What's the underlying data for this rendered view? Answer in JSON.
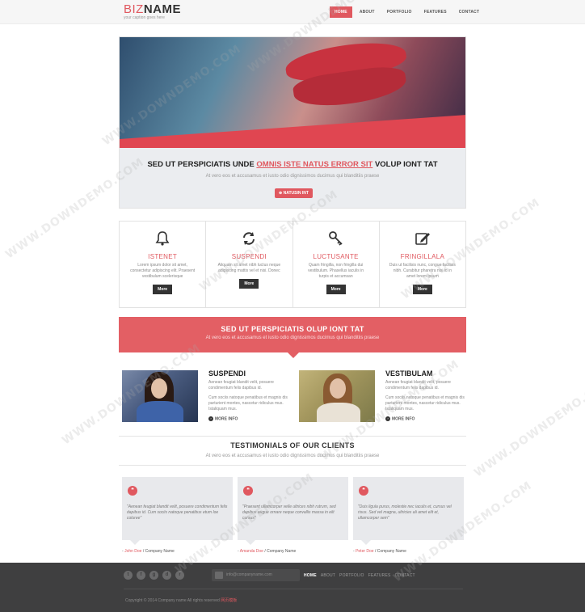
{
  "header": {
    "logo_biz": "BIZ",
    "logo_name": "NAME",
    "tagline": "your caption goes here",
    "nav": [
      "HOME",
      "ABOUT",
      "PORTFOLIO",
      "FEATURES",
      "CONTACT"
    ]
  },
  "hero": {
    "title_before": "SED UT PERSPICIATIS UNDE ",
    "title_highlight": "OMNIS ISTE NATUS ERROR SIT",
    "title_after": " VOLUP IONT TAT",
    "subtitle": "At vero eos et accusamus et iusto odio dignissimos ducimus qui blanditiis praese",
    "button_label": "NATUSIN INT"
  },
  "features": [
    {
      "icon": "bell-icon",
      "title": "ISTENET",
      "text": "Lorem ipsum dolor sit amet, consectetur adipiscing elit. Praesent vestibulum scelerisque",
      "button": "More"
    },
    {
      "icon": "refresh-icon",
      "title": "SUSPENDI",
      "text": "Aliquam sit amet nibh luctus neque adipiscing mattis vel et nisi. Donec",
      "button": "More"
    },
    {
      "icon": "key-icon",
      "title": "LUCTUSANTE",
      "text": "Quam fringilla, non fringilla dui vestibulum. Phasellus iaculis in turpis et accumsan",
      "button": "More"
    },
    {
      "icon": "edit-icon",
      "title": "FRINGILLALA",
      "text": "Duis ut facilisis nunc, congue facilisis nibh. Curabitur pharetra nisi id in amet lorem ipsum",
      "button": "More"
    }
  ],
  "banner": {
    "title": "SED UT PERSPICIATIS OLUP IONT TAT",
    "subtitle": "At vero eos et accusamus et iusto odio dignissimos ducimus qui blanditiis praese"
  },
  "profiles": [
    {
      "title": "SUSPENDI",
      "text1": "Aenean feugiat blandit velit, posuere condimentum felis dapibus id.",
      "text2": "Cum sociis natoque penatibus et magnis dis parturient montes, nascetur ridiculus mus. Istaliquam mus.",
      "more": "MORE INFO"
    },
    {
      "title": "VESTIBULAM",
      "text1": "Aenean feugiat blandit velit, posuere condimentum felis dapibus id.",
      "text2": "Cum sociis natoque penatibus et magnis dis parturient montes, nascetur ridiculus mus. Istaliquam mus.",
      "more": "MORE INFO"
    }
  ],
  "testimonials": {
    "title": "TESTIMONIALS OF OUR CLIENTS",
    "subtitle": "At vero eos et accusamus et iusto odio dignissimos ducimus qui blanditiis praese",
    "items": [
      {
        "quote": "\"Aenean feugiat blandit velit, posuere condimentum felis dapibus id. Cum sociis natoque penatibus etum loe coluree\"",
        "author": "John Doe",
        "company": " / Company Name"
      },
      {
        "quote": "\"Praesent ullamcorper velle ultrices nibh rutrum, sed dapibus augue ornare neque convallis massa in elit cursus\"",
        "author": "Amanda Doe",
        "company": " / Company Name"
      },
      {
        "quote": "\"Duis ligula purus, molestie nec iaculis et, cursus vel risus. Sed vel magna, ultricies ali amet elit et, ullamcorper sem\"",
        "author": "Peter Doe",
        "company": " / Company Name"
      }
    ]
  },
  "footer": {
    "social": [
      "twitter-icon",
      "facebook-icon",
      "google-plus-icon",
      "dribbble-icon",
      "rss-icon"
    ],
    "social_glyphs": [
      "t",
      "f",
      "g",
      "d",
      "r"
    ],
    "email": "info@companyname.com",
    "nav": [
      "HOME",
      "ABOUT",
      "PORTFOLIO",
      "FEATURES",
      "CONTACT"
    ],
    "copyright": "Copyright © 2014 Company name All rights reserved ",
    "copyright_link": "网页模板"
  },
  "watermark": "WWW.DOWNDEMO.COM",
  "colors": {
    "accent": "#e0585f",
    "footer_bg": "#3f3f40",
    "card_bg": "#e8e9ec"
  }
}
